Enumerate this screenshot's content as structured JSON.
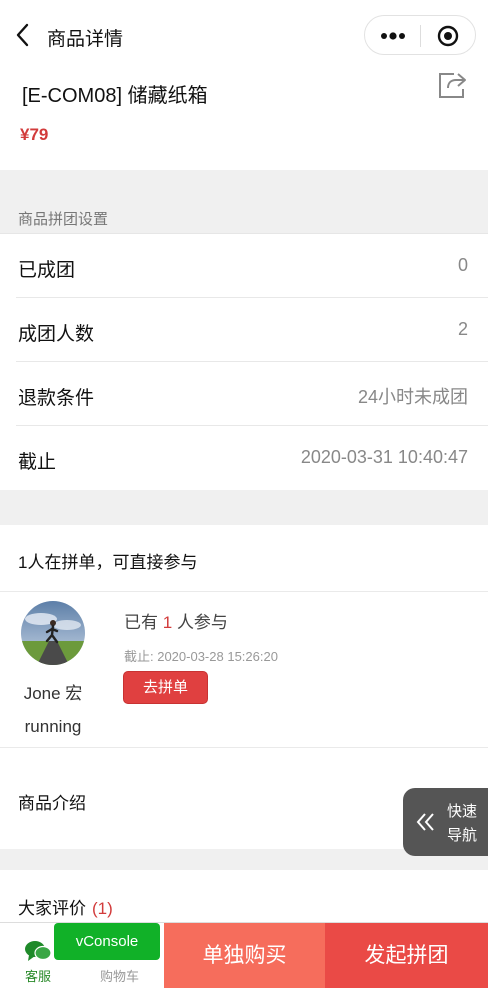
{
  "nav": {
    "title": "商品详情"
  },
  "product": {
    "title": "[E-COM08] 储藏纸箱",
    "price": "¥79"
  },
  "group_settings": {
    "section_label": "商品拼团设置",
    "rows": [
      {
        "label": "已成团",
        "value": "0"
      },
      {
        "label": "成团人数",
        "value": "2"
      },
      {
        "label": "退款条件",
        "value": "24小时未成团"
      },
      {
        "label": "截止",
        "value": "2020-03-31 10:40:47"
      }
    ]
  },
  "join": {
    "header": "1人在拼单，可直接参与",
    "user_name": "Jone 宏 running",
    "joined_prefix": "已有",
    "joined_count": "1",
    "joined_suffix": "人参与",
    "deadline": "截止: 2020-03-28 15:26:20",
    "button": "去拼单"
  },
  "intro": {
    "title": "商品介绍"
  },
  "reviews": {
    "title": "大家评价",
    "count": "(1)"
  },
  "quick_nav": {
    "line1": "快速",
    "line2": "导航"
  },
  "bottom_bar": {
    "service_label": "客服",
    "cart_label": "购物车",
    "vconsole": "vConsole",
    "buy_single": "单独购买",
    "start_group": "发起拼团"
  },
  "colors": {
    "accent_red": "#d23b3b",
    "buy_single_bg": "#f66d5c",
    "start_group_bg": "#ea4a46",
    "vconsole_green": "#11b128"
  }
}
